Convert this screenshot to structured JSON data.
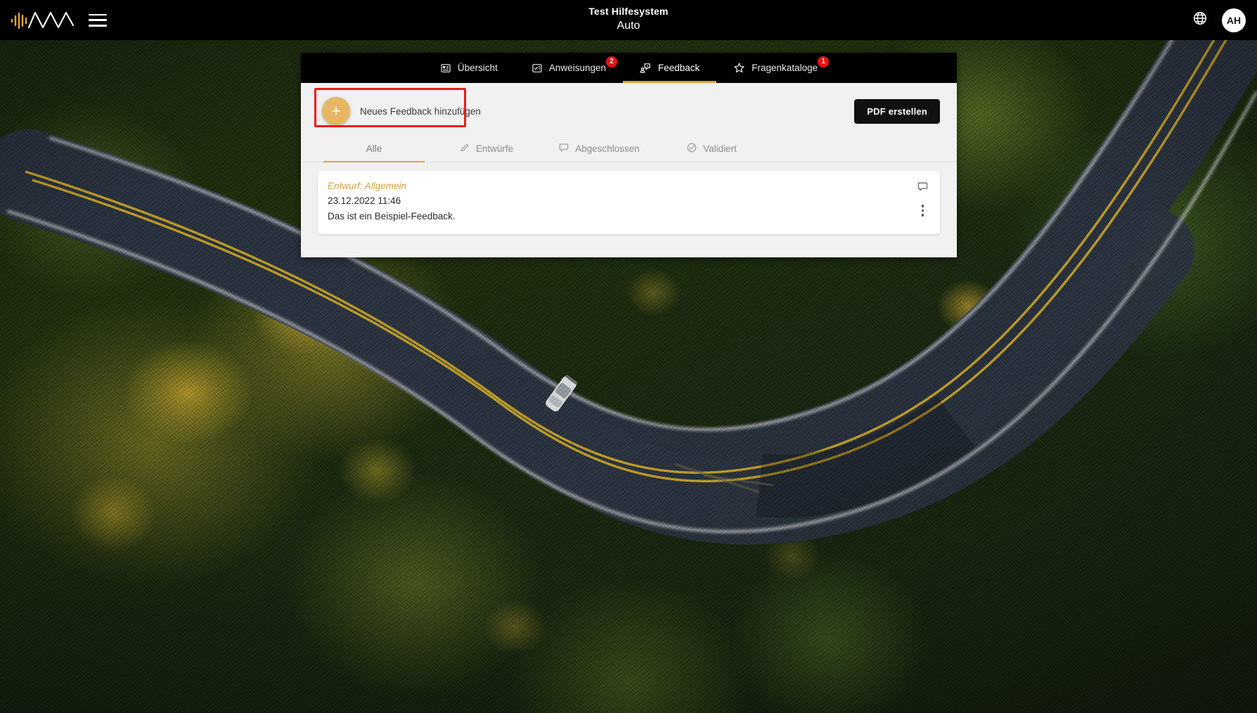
{
  "topbar": {
    "logo_icon": "waveform-logo-icon",
    "menu_icon": "hamburger-menu-icon",
    "title": "Test Hilfesystem",
    "subtitle": "Auto",
    "language_icon": "globe-icon",
    "avatar_initials": "AH"
  },
  "tabs": [
    {
      "label": "Übersicht",
      "icon": "overview-icon",
      "badge": "",
      "active": false
    },
    {
      "label": "Anweisungen",
      "icon": "tasklist-icon",
      "badge": "2",
      "active": false
    },
    {
      "label": "Feedback",
      "icon": "feedback-icon",
      "badge": "",
      "active": true
    },
    {
      "label": "Fragenkataloge",
      "icon": "star-icon",
      "badge": "1",
      "active": false
    }
  ],
  "toolbar": {
    "add_feedback_label": "Neues Feedback hinzufügen",
    "add_icon": "plus-icon",
    "pdf_label": "PDF erstellen"
  },
  "filters": [
    {
      "label": "Alle",
      "icon": "",
      "active": true
    },
    {
      "label": "Entwürfe",
      "icon": "pencil-icon",
      "active": false
    },
    {
      "label": "Abgeschlossen",
      "icon": "comment-icon",
      "active": false
    },
    {
      "label": "Validiert",
      "icon": "check-circle-icon",
      "active": false
    }
  ],
  "feedback_items": [
    {
      "title": "Entwurf: Allgemein",
      "date": "23.12.2022 11:46",
      "text": "Das ist ein Beispiel-Feedback.",
      "comment_icon": "comment-icon",
      "menu_icon": "more-vertical-icon"
    }
  ],
  "colors": {
    "accent_gold": "#d9a441",
    "fab_gold": "#e8b765",
    "badge_red": "#e8120f",
    "highlight_red": "#ef1b15",
    "topbar_black": "#000000",
    "panel_gray": "#f1f1f1"
  },
  "background": {
    "description": "Aerial photograph of a winding two-lane road with yellow centre line through an autumn forest, white car on the road"
  }
}
